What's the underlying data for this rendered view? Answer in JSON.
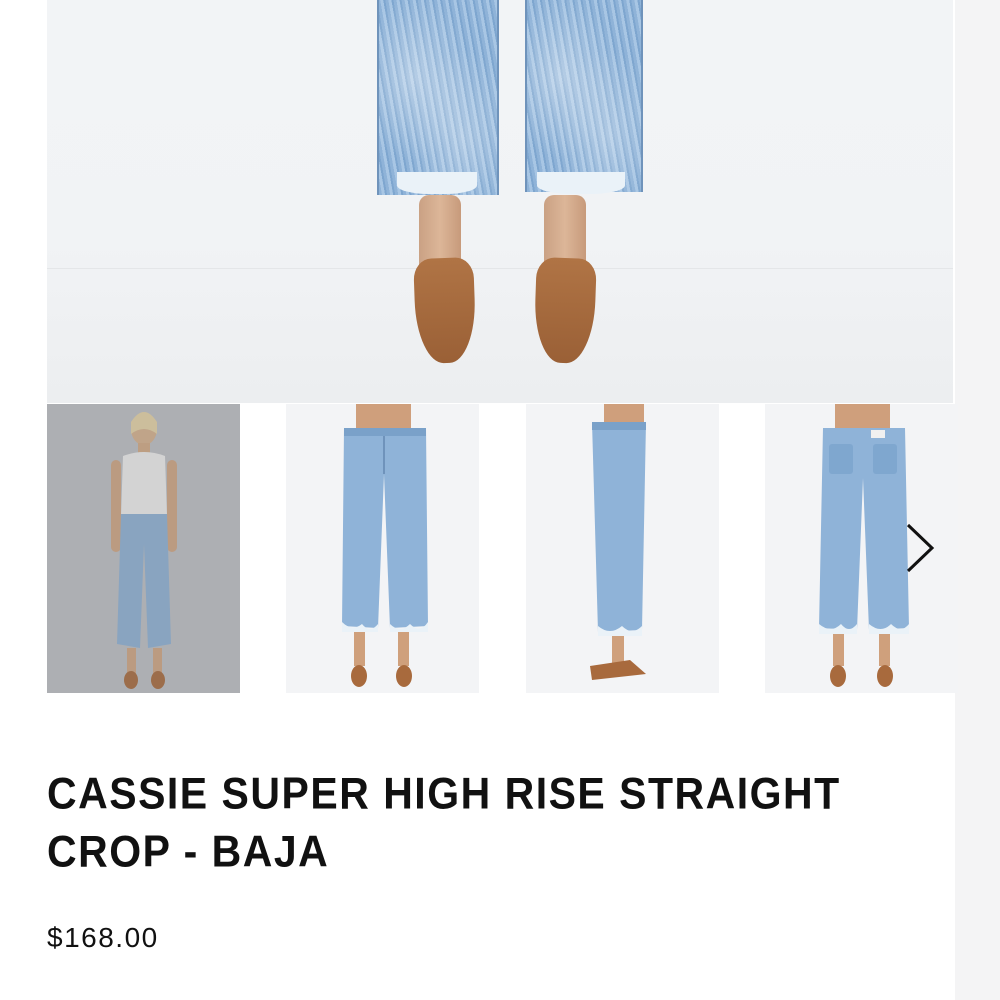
{
  "product": {
    "title": "CASSIE SUPER HIGH RISE STRAIGHT CROP - BAJA",
    "price": "$168.00"
  },
  "gallery": {
    "thumbnails": [
      {
        "id": "thumb-1",
        "view": "full-body-front",
        "selected": true
      },
      {
        "id": "thumb-2",
        "view": "front"
      },
      {
        "id": "thumb-3",
        "view": "side"
      },
      {
        "id": "thumb-4",
        "view": "back"
      }
    ],
    "next_icon": "chevron-right-icon"
  },
  "colors": {
    "denim": "#8fb3d8",
    "shoe": "#a86a3d",
    "text": "#111111"
  }
}
